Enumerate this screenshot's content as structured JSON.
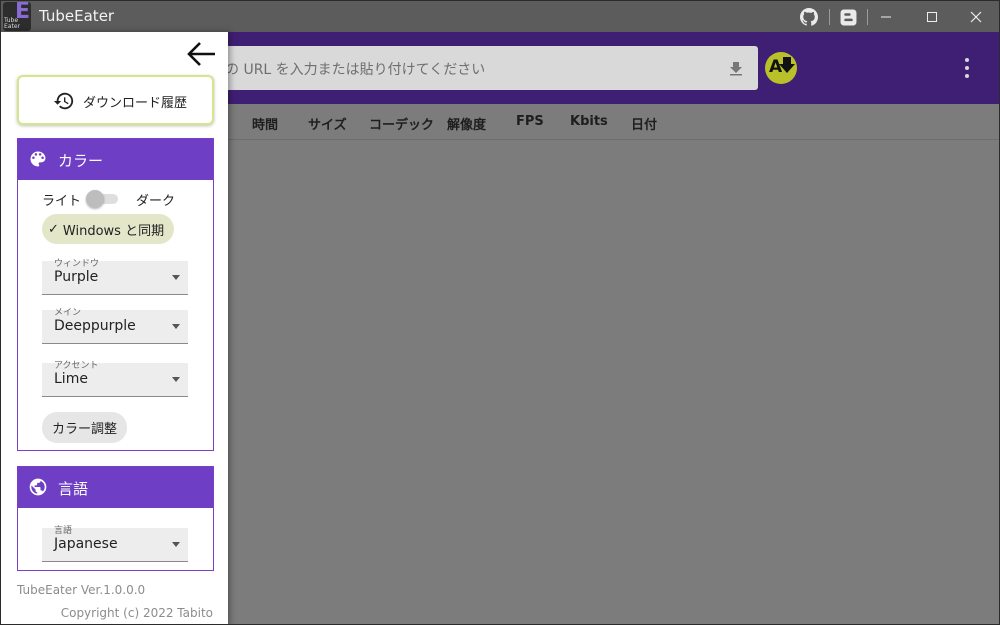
{
  "window": {
    "title": "TubeEater",
    "logo_letter": "E",
    "logo_text": "Tube Eater"
  },
  "titlebar": {
    "icons": [
      "github-icon",
      "blogger-icon"
    ],
    "buttons": [
      "minimize",
      "maximize",
      "close"
    ]
  },
  "header": {
    "url_placeholder": "の URL を入力または貼り付けてください",
    "avatar_letter": "A"
  },
  "columns": [
    "時間",
    "サイズ",
    "コーデック",
    "解像度",
    "FPS",
    "Kbits",
    "日付"
  ],
  "drawer": {
    "history_label": "ダウンロード履歴",
    "color_card": {
      "title": "カラー",
      "light_label": "ライト",
      "dark_label": "ダーク",
      "dark_mode_on": false,
      "sync_chip_check": "✓",
      "sync_chip_label": "Windows と同期",
      "window_caption": "ウィンドウ",
      "window_value": "Purple",
      "main_caption": "メイン",
      "main_value": "Deeppurple",
      "accent_caption": "アクセント",
      "accent_value": "Lime",
      "adjust_label": "カラー調整"
    },
    "language_card": {
      "title": "言語",
      "caption": "言語",
      "value": "Japanese"
    },
    "version": "TubeEater Ver.1.0.0.0",
    "copyright": "Copyright (c) 2022 Tabito"
  },
  "colors": {
    "primary": "#6e3ec4",
    "header_dimmed": "#3f1f73",
    "accent": "#c0ca33",
    "overlay": "#7c7c7c"
  }
}
